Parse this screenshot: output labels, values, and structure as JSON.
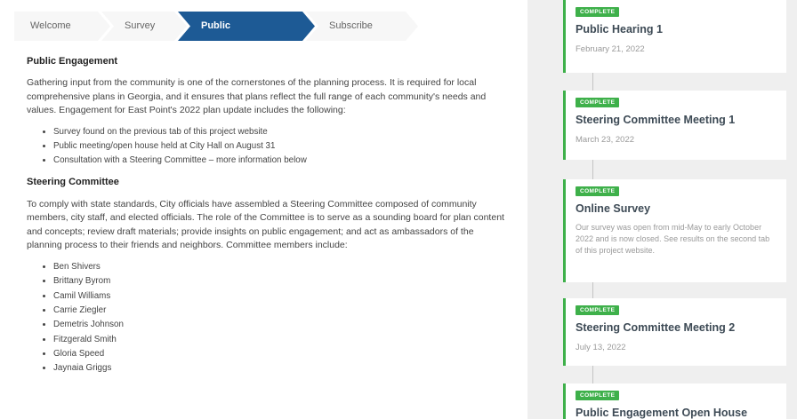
{
  "tabs": [
    {
      "label": "Welcome",
      "active": false
    },
    {
      "label": "Survey",
      "active": false
    },
    {
      "label": "Public Engagement",
      "active": true
    },
    {
      "label": "Subscribe",
      "active": false
    }
  ],
  "main": {
    "engagement_heading": "Public Engagement",
    "engagement_paragraph": "Gathering input from the community is one of the cornerstones of the planning process. It is required for local comprehensive plans in Georgia, and it ensures that plans reflect the full range of each community's needs and values. Engagement for East Point's 2022 plan update includes the following:",
    "engagement_items": [
      "Survey found on the previous tab of this project website",
      "Public meeting/open house held at City Hall on August 31",
      "Consultation with a Steering Committee – more information below"
    ],
    "committee_heading": "Steering Committee",
    "committee_paragraph": "To comply with state standards, City officials have assembled a Steering Committee composed of community members, city staff, and elected officials. The role of the Committee is to serve as a sounding board for plan content and concepts; review draft materials; provide insights on public engagement; and act as ambassadors of the planning process to their friends and neighbors. Committee members include:",
    "members": [
      "Ben Shivers",
      "Brittany Byrom",
      "Camil Williams",
      "Carrie Ziegler",
      "Demetris Johnson",
      "Fitzgerald Smith",
      "Gloria Speed",
      "Jaynaia Griggs"
    ]
  },
  "timeline": [
    {
      "badge": "COMPLETE",
      "title": "Public Hearing 1",
      "date": "February 21, 2022"
    },
    {
      "badge": "COMPLETE",
      "title": "Steering Committee Meeting 1",
      "date": "March 23, 2022"
    },
    {
      "badge": "COMPLETE",
      "title": "Online Survey",
      "description": "Our survey was open from mid-May to early October 2022 and is now closed. See results on the second tab of this project website."
    },
    {
      "badge": "COMPLETE",
      "title": "Steering Committee Meeting 2",
      "date": "July 13, 2022"
    },
    {
      "badge": "COMPLETE",
      "title": "Public Engagement Open House"
    }
  ],
  "colors": {
    "active_tab": "#1d5a95",
    "complete_badge": "#3eb04a",
    "sidebar_bg": "#efefef"
  }
}
